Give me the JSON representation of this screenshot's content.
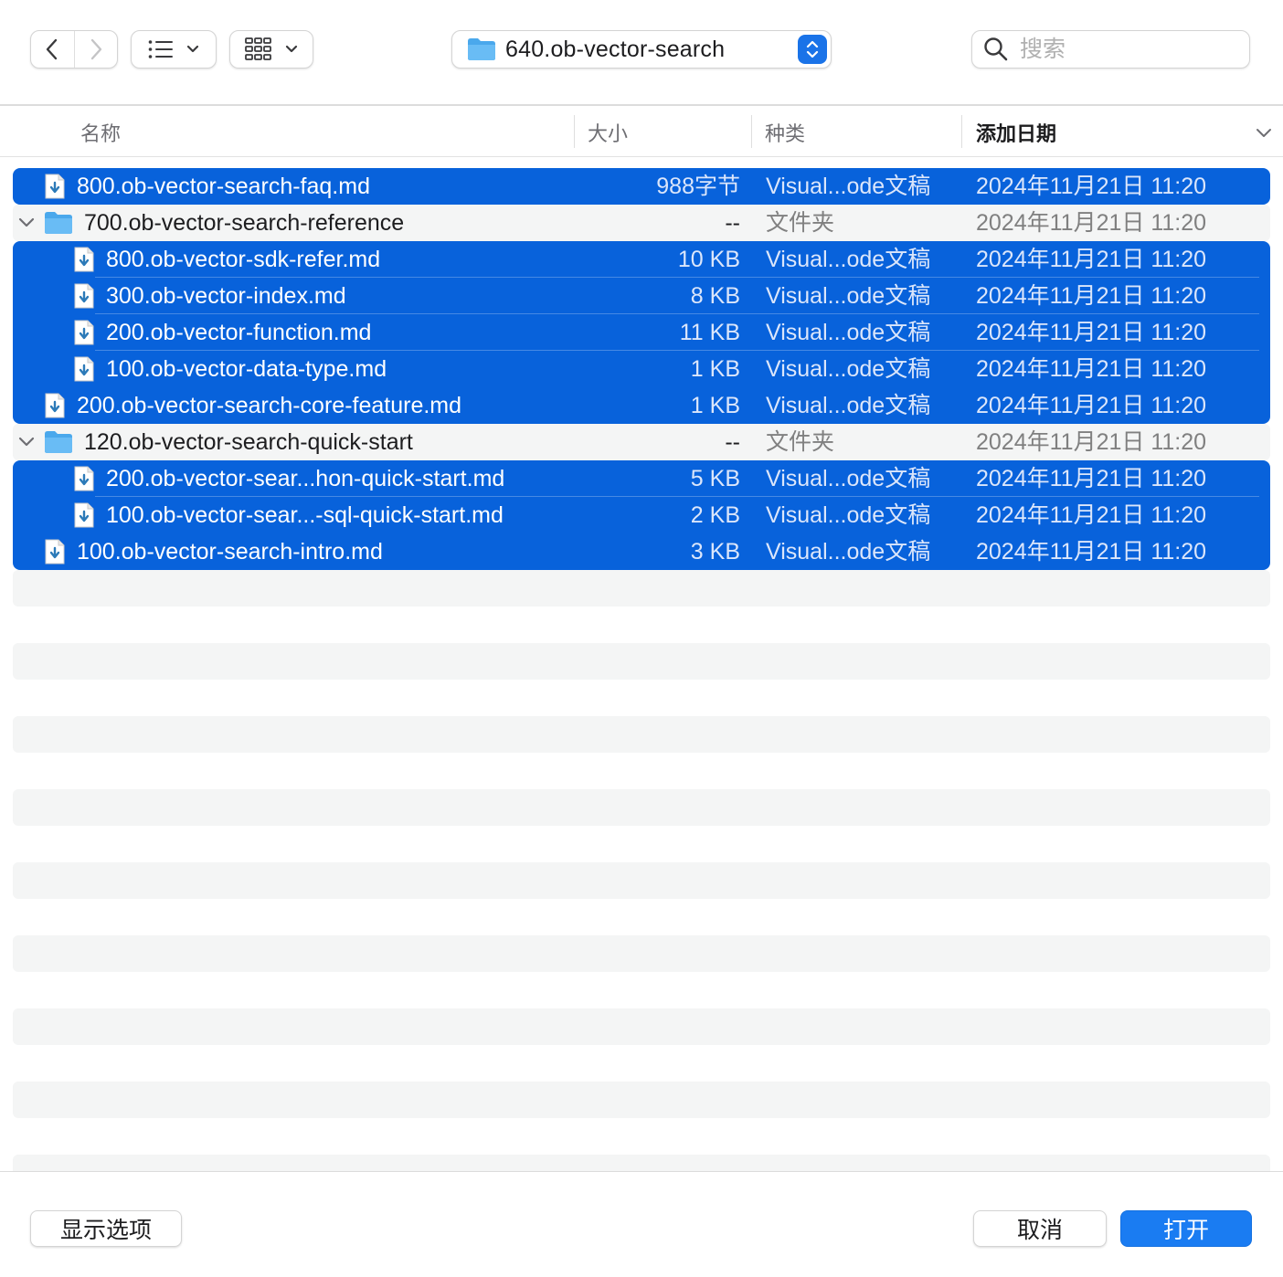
{
  "toolbar": {
    "back_icon": "chevron-left-icon",
    "forward_icon": "chevron-right-icon",
    "list_view_icon": "list-icon",
    "group_icon": "grid-icon",
    "path": {
      "label": "640.ob-vector-search",
      "icon": "folder-icon"
    },
    "search": {
      "placeholder": "搜索",
      "value": ""
    }
  },
  "columns": {
    "name": "名称",
    "size": "大小",
    "kind": "种类",
    "date_added": "添加日期",
    "sorted_by": "date_added"
  },
  "rows": [
    {
      "name": "800.ob-vector-search-faq.md",
      "size": "988字节",
      "kind": "Visual...ode文稿",
      "date": "2024年11月21日 11:20",
      "selected": true,
      "type": "file",
      "indent": 0
    },
    {
      "name": "700.ob-vector-search-reference",
      "size": "--",
      "kind": "文件夹",
      "date": "2024年11月21日 11:20",
      "selected": false,
      "type": "folder",
      "indent": 0,
      "expanded": true
    },
    {
      "name": "800.ob-vector-sdk-refer.md",
      "size": "10 KB",
      "kind": "Visual...ode文稿",
      "date": "2024年11月21日 11:20",
      "selected": true,
      "type": "file",
      "indent": 1
    },
    {
      "name": "300.ob-vector-index.md",
      "size": "8 KB",
      "kind": "Visual...ode文稿",
      "date": "2024年11月21日 11:20",
      "selected": true,
      "type": "file",
      "indent": 1
    },
    {
      "name": "200.ob-vector-function.md",
      "size": "11 KB",
      "kind": "Visual...ode文稿",
      "date": "2024年11月21日 11:20",
      "selected": true,
      "type": "file",
      "indent": 1
    },
    {
      "name": "100.ob-vector-data-type.md",
      "size": "1 KB",
      "kind": "Visual...ode文稿",
      "date": "2024年11月21日 11:20",
      "selected": true,
      "type": "file",
      "indent": 1
    },
    {
      "name": "200.ob-vector-search-core-feature.md",
      "size": "1 KB",
      "kind": "Visual...ode文稿",
      "date": "2024年11月21日 11:20",
      "selected": true,
      "type": "file",
      "indent": 0
    },
    {
      "name": "120.ob-vector-search-quick-start",
      "size": "--",
      "kind": "文件夹",
      "date": "2024年11月21日 11:20",
      "selected": false,
      "type": "folder",
      "indent": 0,
      "expanded": true
    },
    {
      "name": "200.ob-vector-sear...hon-quick-start.md",
      "size": "5 KB",
      "kind": "Visual...ode文稿",
      "date": "2024年11月21日 11:20",
      "selected": true,
      "type": "file",
      "indent": 1
    },
    {
      "name": "100.ob-vector-sear...-sql-quick-start.md",
      "size": "2 KB",
      "kind": "Visual...ode文稿",
      "date": "2024年11月21日 11:20",
      "selected": true,
      "type": "file",
      "indent": 1
    },
    {
      "name": "100.ob-vector-search-intro.md",
      "size": "3 KB",
      "kind": "Visual...ode文稿",
      "date": "2024年11月21日 11:20",
      "selected": true,
      "type": "file",
      "indent": 0
    }
  ],
  "footer": {
    "options_label": "显示选项",
    "cancel_label": "取消",
    "open_label": "打开"
  },
  "colors": {
    "selection": "#0862db",
    "primary_button": "#1a7cf2",
    "stripe": "#f4f5f5",
    "folder": "#5ab4f0"
  }
}
